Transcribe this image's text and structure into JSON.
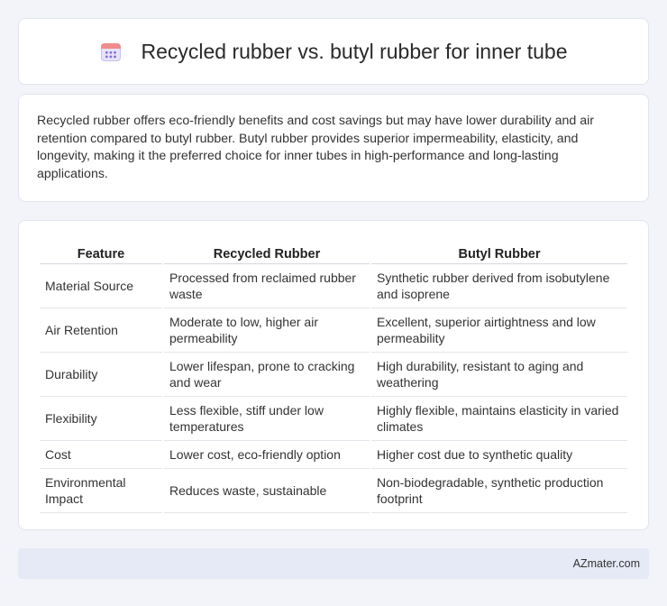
{
  "header": {
    "title": "Recycled rubber vs. butyl rubber for inner tube",
    "icon": "calendar-icon"
  },
  "summary": {
    "text": "Recycled rubber offers eco-friendly benefits and cost savings but may have lower durability and air retention compared to butyl rubber. Butyl rubber provides superior impermeability, elasticity, and longevity, making it the preferred choice for inner tubes in high-performance and long-lasting applications."
  },
  "table": {
    "headers": [
      "Feature",
      "Recycled Rubber",
      "Butyl Rubber"
    ],
    "rows": [
      [
        "Material Source",
        "Processed from reclaimed rubber waste",
        "Synthetic rubber derived from isobutylene and isoprene"
      ],
      [
        "Air Retention",
        "Moderate to low, higher air permeability",
        "Excellent, superior airtightness and low permeability"
      ],
      [
        "Durability",
        "Lower lifespan, prone to cracking and wear",
        "High durability, resistant to aging and weathering"
      ],
      [
        "Flexibility",
        "Less flexible, stiff under low temperatures",
        "Highly flexible, maintains elasticity in varied climates"
      ],
      [
        "Cost",
        "Lower cost, eco-friendly option",
        "Higher cost due to synthetic quality"
      ],
      [
        "Environmental Impact",
        "Reduces waste, sustainable",
        "Non-biodegradable, synthetic production footprint"
      ]
    ]
  },
  "footer": {
    "brand": "AZmater.com"
  }
}
